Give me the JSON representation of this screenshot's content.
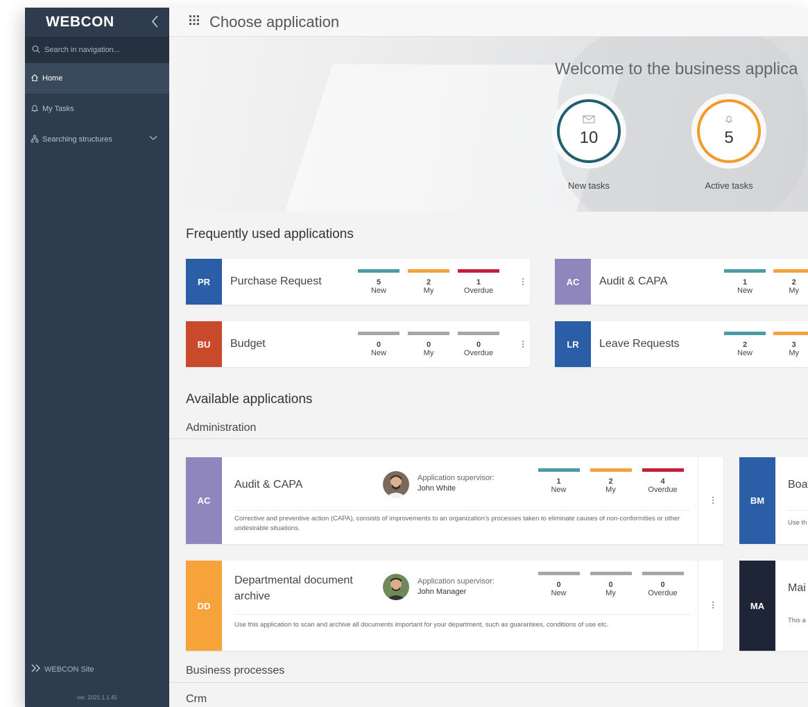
{
  "sidebar": {
    "logo": "WEBCON",
    "search_placeholder": "Search in navigation...",
    "items": [
      {
        "label": "Home",
        "icon": "home-icon",
        "active": true
      },
      {
        "label": "My Tasks",
        "icon": "bell-icon",
        "active": false
      },
      {
        "label": "Searching structures",
        "icon": "structure-icon",
        "active": false
      }
    ],
    "footer_link": "WEBCON Site",
    "version": "ver. 2021.1.1.45"
  },
  "topbar": {
    "title": "Choose application"
  },
  "hero": {
    "welcome": "Welcome to the business applica",
    "counters": [
      {
        "value": "10",
        "label": "New tasks",
        "color": "#1f5f6e",
        "icon": "mail-icon"
      },
      {
        "value": "5",
        "label": "Active tasks",
        "color": "#f39a2a",
        "icon": "bell-icon"
      }
    ]
  },
  "frequent": {
    "heading": "Frequently used applications",
    "apps": [
      {
        "abbr": "PR",
        "name": "Purchase Request",
        "color": "#2a5fa8",
        "stats": [
          {
            "v": "5",
            "l": "New"
          },
          {
            "v": "2",
            "l": "My"
          },
          {
            "v": "1",
            "l": "Overdue"
          }
        ],
        "active": true
      },
      {
        "abbr": "AC",
        "name": "Audit & CAPA",
        "color": "#8e86bd",
        "stats": [
          {
            "v": "1",
            "l": "New"
          },
          {
            "v": "2",
            "l": "My"
          }
        ],
        "active": true
      },
      {
        "abbr": "BU",
        "name": "Budget",
        "color": "#c94a2b",
        "stats": [
          {
            "v": "0",
            "l": "New"
          },
          {
            "v": "0",
            "l": "My"
          },
          {
            "v": "0",
            "l": "Overdue"
          }
        ],
        "active": false
      },
      {
        "abbr": "LR",
        "name": "Leave Requests",
        "color": "#2a5fa8",
        "stats": [
          {
            "v": "2",
            "l": "New"
          },
          {
            "v": "3",
            "l": "My"
          }
        ],
        "active": true
      }
    ]
  },
  "available": {
    "heading": "Available applications",
    "group": "Administration",
    "supervisor_label": "Application supervisor:",
    "apps": [
      {
        "abbr": "AC",
        "name": "Audit & CAPA",
        "color": "#8e86bd",
        "supervisor": "John White",
        "stats": [
          {
            "v": "1",
            "l": "New"
          },
          {
            "v": "2",
            "l": "My"
          },
          {
            "v": "4",
            "l": "Overdue"
          }
        ],
        "desc": "Corrective and preventive action (CAPA), consists of improvements to an organization's processes taken to eliminate causes of non-conformities or other undesirable situations."
      },
      {
        "abbr": "DD",
        "name": "Departmental document archive",
        "color": "#f6a33a",
        "supervisor": "John Manager",
        "stats": [
          {
            "v": "0",
            "l": "New"
          },
          {
            "v": "0",
            "l": "My"
          },
          {
            "v": "0",
            "l": "Overdue"
          }
        ],
        "desc": "Use this application to scan and archive all documents important for your department, such as guarantees, conditions of use etc."
      },
      {
        "abbr": "BM",
        "name": "Boa",
        "color": "#2a5fa8",
        "desc": "Use th"
      },
      {
        "abbr": "MA",
        "name": "Mai",
        "color": "#1e2536",
        "desc": "This a"
      }
    ],
    "more_groups": [
      "Business processes",
      "Crm"
    ]
  },
  "colors": {
    "new": "#4a9aa7",
    "my": "#f4a13e",
    "overdue": "#c41e3a",
    "inactive": "#a6a6a6"
  }
}
